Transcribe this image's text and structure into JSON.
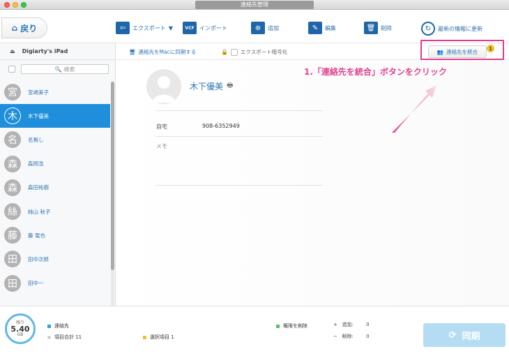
{
  "window": {
    "title": "連絡先管理"
  },
  "toolbar": {
    "back_label": "戻り",
    "export_label": "エクスポート",
    "import_label": "インポート",
    "add_label": "追加",
    "edit_label": "編集",
    "delete_label": "削除",
    "refresh_label": "最新の情報に更新",
    "vcf_icon_text": "VCF"
  },
  "sidebar": {
    "device_name": "Digiarty's iPad",
    "search_placeholder": "検索",
    "contacts": [
      {
        "initial": "宮",
        "name": "宮崎美子",
        "selected": false
      },
      {
        "initial": "木",
        "name": "木下優美",
        "selected": true
      },
      {
        "initial": "名",
        "name": "名無し",
        "selected": false
      },
      {
        "initial": "森",
        "name": "森岡浩",
        "selected": false
      },
      {
        "initial": "森",
        "name": "森田祐樹",
        "selected": false
      },
      {
        "initial": "絲",
        "name": "絲山 秋子",
        "selected": false
      },
      {
        "initial": "藤",
        "name": "藤 竜也",
        "selected": false
      },
      {
        "initial": "田",
        "name": "田中次郎",
        "selected": false
      },
      {
        "initial": "田",
        "name": "田中一",
        "selected": false
      }
    ],
    "scroll_fraction": 0.84
  },
  "detail_header": {
    "sync_mac_label": "連絡先をMacに同期する",
    "encrypt_label": "エクスポート暗号化",
    "merge_label": "連絡先を統合",
    "merge_badge": "1"
  },
  "detail": {
    "name": "木下優美",
    "phone_label": "自宅",
    "phone_value": "908-6352949",
    "memo_label": "メモ"
  },
  "annotation": {
    "text": "1.「連絡先を統合」ボタンをクリック",
    "color": "#e0428f"
  },
  "footer": {
    "storage_label": "残り",
    "storage_value": "5.40",
    "storage_unit": "GB",
    "legend_contacts": "連絡先",
    "total_items": "項目合計 11",
    "selected_items": "選択項目 1",
    "perm_delete": "権限を削除",
    "add_label": "追加:",
    "add_count": "0",
    "del_label": "削除:",
    "del_count": "0",
    "sync_label": "同期"
  },
  "colors": {
    "accent": "#1f8fdb",
    "toolbar_icon": "#1f66a8",
    "legend_contacts": "#3aa0e0",
    "legend_selected": "#f0c02b",
    "legend_total": "#cfcfcf",
    "legend_perm": "#5cbf6a"
  }
}
